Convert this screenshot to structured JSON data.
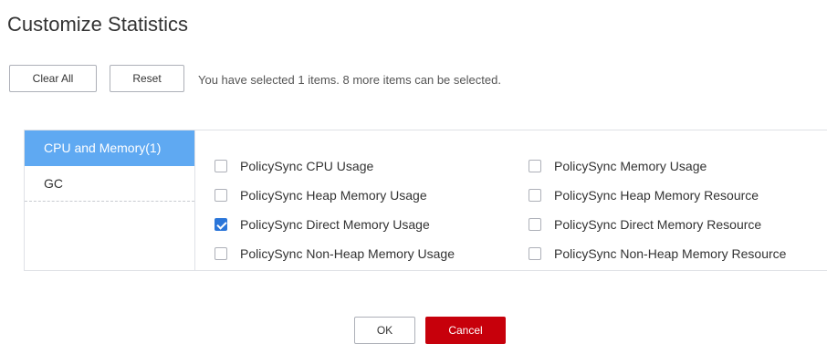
{
  "dialog": {
    "title": "Customize Statistics"
  },
  "toolbar": {
    "clear_all_label": "Clear All",
    "reset_label": "Reset",
    "selection_info": "You have selected 1 items. 8 more items can be selected."
  },
  "categories": [
    {
      "label": "CPU and Memory(1)",
      "active": true
    },
    {
      "label": "GC",
      "active": false
    }
  ],
  "metrics": [
    {
      "label": "PolicySync CPU Usage",
      "checked": false
    },
    {
      "label": "PolicySync Memory Usage",
      "checked": false
    },
    {
      "label": "PolicySync Heap Memory Usage",
      "checked": false
    },
    {
      "label": "PolicySync Heap Memory Resource",
      "checked": false
    },
    {
      "label": "PolicySync Direct Memory Usage",
      "checked": true
    },
    {
      "label": "PolicySync Direct Memory Resource",
      "checked": false
    },
    {
      "label": "PolicySync Non-Heap Memory Usage",
      "checked": false
    },
    {
      "label": "PolicySync Non-Heap Memory Resource",
      "checked": false
    }
  ],
  "footer": {
    "ok_label": "OK",
    "cancel_label": "Cancel"
  },
  "colors": {
    "active_category": "#5fa9f2",
    "checkbox_checked": "#2b76d9",
    "cancel_button": "#c7000b"
  }
}
